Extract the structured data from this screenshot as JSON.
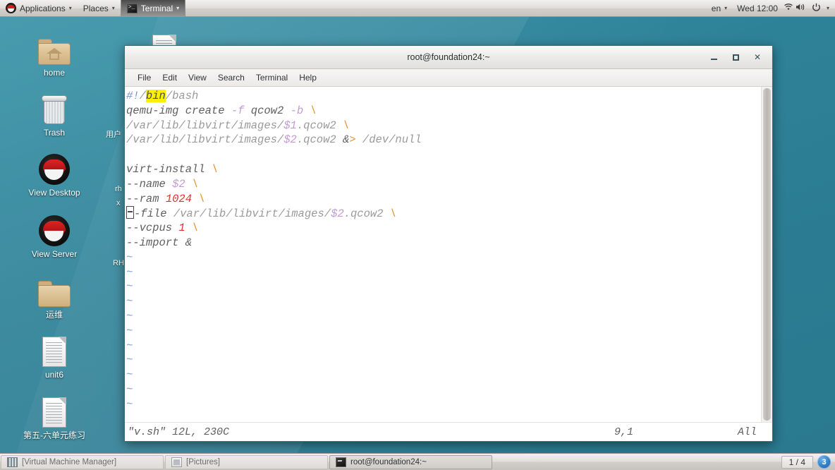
{
  "top_panel": {
    "logo_icon": "redhat-logo-icon",
    "applications_label": "Applications",
    "places_label": "Places",
    "active_app_label": "Terminal",
    "active_app_icon": "terminal-icon",
    "caret": "▾",
    "keyboard_layout": "en",
    "clock": "Wed 12:00",
    "network_icon": "ᴗ",
    "volume_icon": "volume-icon",
    "power_icon": "power-icon"
  },
  "desktop_icons": [
    {
      "label": "home",
      "icon": "home-folder-icon",
      "type": "folder-home"
    },
    {
      "label": "Trash",
      "icon": "trash-icon",
      "type": "trash"
    },
    {
      "label": "View Desktop",
      "icon": "redhat-logo-icon",
      "type": "redhat"
    },
    {
      "label": "View Server",
      "icon": "redhat-logo-icon",
      "type": "redhat"
    },
    {
      "label": "运维",
      "icon": "folder-icon",
      "type": "folder"
    },
    {
      "label": "unit6",
      "icon": "document-icon",
      "type": "doc"
    },
    {
      "label": "第五-六单元练习",
      "icon": "document-icon",
      "type": "doc"
    }
  ],
  "background_fragments": [
    {
      "text": "用户"
    },
    {
      "text": "rh"
    },
    {
      "text": "x"
    },
    {
      "text": "RH"
    }
  ],
  "terminal": {
    "title": "root@foundation24:~",
    "window_buttons": {
      "minimize": "minimize-button",
      "maximize": "maximize-button",
      "close": "✕"
    },
    "menu": [
      "File",
      "Edit",
      "View",
      "Search",
      "Terminal",
      "Help"
    ],
    "editor_lines": [
      [
        {
          "t": "#!",
          "c": "c-comment"
        },
        {
          "t": "/",
          "c": "c-path"
        },
        {
          "t": "bin",
          "c": "c-path c-hl"
        },
        {
          "t": "/bash",
          "c": "c-path"
        }
      ],
      [
        {
          "t": "qemu-img create ",
          "c": "c-plain"
        },
        {
          "t": "-f",
          "c": "c-opt"
        },
        {
          "t": " qcow2 ",
          "c": "c-plain"
        },
        {
          "t": "-b",
          "c": "c-opt"
        },
        {
          "t": " ",
          "c": "c-plain"
        },
        {
          "t": "\\",
          "c": "c-cont"
        }
      ],
      [
        {
          "t": "/var/lib/libvirt/images/",
          "c": "c-path"
        },
        {
          "t": "$1",
          "c": "c-var"
        },
        {
          "t": ".qcow2",
          "c": "c-path"
        },
        {
          "t": " ",
          "c": "c-plain"
        },
        {
          "t": "\\",
          "c": "c-cont"
        }
      ],
      [
        {
          "t": "/var/lib/libvirt/images/",
          "c": "c-path"
        },
        {
          "t": "$2",
          "c": "c-var"
        },
        {
          "t": ".qcow2",
          "c": "c-path"
        },
        {
          "t": " &",
          "c": "c-plain"
        },
        {
          "t": ">",
          "c": "c-redir"
        },
        {
          "t": " /dev/null",
          "c": "c-path"
        }
      ],
      [],
      [
        {
          "t": "virt-install ",
          "c": "c-plain"
        },
        {
          "t": "\\",
          "c": "c-cont"
        }
      ],
      [
        {
          "t": "--name ",
          "c": "c-plain"
        },
        {
          "t": "$2",
          "c": "c-var"
        },
        {
          "t": " ",
          "c": "c-plain"
        },
        {
          "t": "\\",
          "c": "c-cont"
        }
      ],
      [
        {
          "t": "--ram ",
          "c": "c-plain"
        },
        {
          "t": "1024",
          "c": "c-num"
        },
        {
          "t": " ",
          "c": "c-plain"
        },
        {
          "t": "\\",
          "c": "c-cont"
        }
      ],
      [
        {
          "t": "CURSOR",
          "c": "cursor"
        },
        {
          "t": "-file ",
          "c": "c-plain"
        },
        {
          "t": "/var/lib/libvirt/images/",
          "c": "c-path"
        },
        {
          "t": "$2",
          "c": "c-var"
        },
        {
          "t": ".qcow2",
          "c": "c-path"
        },
        {
          "t": " ",
          "c": "c-plain"
        },
        {
          "t": "\\",
          "c": "c-cont"
        }
      ],
      [
        {
          "t": "--vcpus ",
          "c": "c-plain"
        },
        {
          "t": "1",
          "c": "c-num"
        },
        {
          "t": " ",
          "c": "c-plain"
        },
        {
          "t": "\\",
          "c": "c-cont"
        }
      ],
      [
        {
          "t": "--import &",
          "c": "c-plain"
        }
      ]
    ],
    "empty_marker": "~",
    "empty_marker_count": 11,
    "status": {
      "file": "\"v.sh\" 12L, 230C",
      "position": "9,1",
      "scope": "All"
    }
  },
  "taskbar": {
    "buttons": [
      {
        "label": "[Virtual Machine Manager]",
        "icon": "vmm-icon",
        "state": "inactive"
      },
      {
        "label": "[Pictures]",
        "icon": "pictures-icon",
        "state": "inactive"
      },
      {
        "label": "root@foundation24:~",
        "icon": "terminal-icon",
        "state": "current"
      }
    ],
    "workspace": "1 / 4",
    "notification_count": "3"
  },
  "colors": {
    "desktop": "#2e8298",
    "panel": "#e0ddd9",
    "highlight": "#fbf000",
    "number": "#e03131",
    "continuation": "#e8962e",
    "variable": "#c39bd3",
    "comment": "#7b8ed2",
    "badge": "#2d7bc4"
  }
}
